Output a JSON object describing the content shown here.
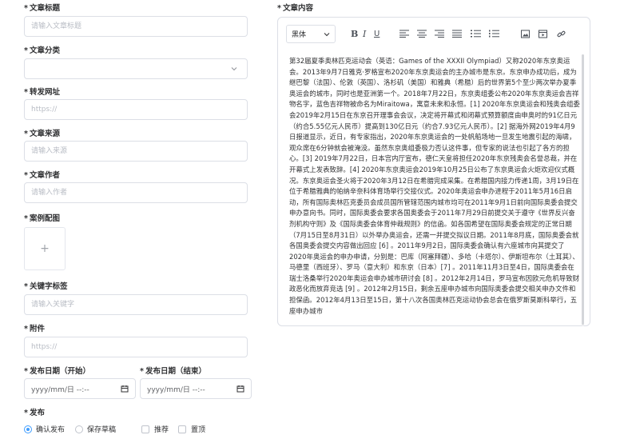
{
  "form": {
    "title_label": "文章标题",
    "title_placeholder": "请输入文章标题",
    "category_label": "文章分类",
    "url_label": "转发网址",
    "url_placeholder": "https://",
    "source_label": "文章来源",
    "source_placeholder": "请输入来源",
    "author_label": "文章作者",
    "author_placeholder": "请输入作者",
    "cover_label": "案例配图",
    "cover_plus": "+",
    "tags_label": "关键字标签",
    "tags_placeholder": "请输入关键字",
    "attachment_label": "附件",
    "attachment_placeholder": "https://",
    "start_date_label": "发布日期（开始）",
    "end_date_label": "发布日期（结束）",
    "date_placeholder": "yyyy/mm/日  --:--",
    "publish_label": "发布",
    "publish_options": [
      "确认发布",
      "保存草稿"
    ],
    "publish_selected": "确认发布",
    "checkboxes": [
      "推荐",
      "置顶"
    ],
    "required_mark": "*"
  },
  "editor": {
    "label": "文章内容",
    "font": "黑体",
    "bold": "B",
    "italic": "I",
    "underline": "U",
    "content": "第32届夏季奥林匹克运动会（英语：Games of the XXXII Olympiad）又称2020年东京奥运会。2013年9月7日雅克·罗格宣布2020年东京奥运会的主办城市是东京。东京申办成功后，成为继巴黎（法国）、伦敦（英国）、洛杉矶（美国）和雅典（希腊）后的世界第5个至少两次举办夏季奥运会的城市，同时也是亚洲第一个。2018年7月22日，东京奥组委公布2020年东京奥运会吉祥物名字，蓝色吉祥物被命名为Miraitowa，寓意未来和永恒。[1] 2020年东京奥运会和残奥会组委会2019年2月15日在东京召开理事会会议，决定将开幕式和闭幕式预算额度由申奥时的91亿日元（约合5.55亿元人民币）提高到130亿日元（约合7.93亿元人民币）。[2] 据海外网2019年4月9日报道显示，近日，有专家指出，2020年东京奥运会的一处帆船场地一旦发生地震引起的海啸，观众席在6分钟就会被淹没。虽然东京奥组委极力否认这件事，但专家的说法也引起了各方的担心。[3] 2019年7月22日，日本宫内厅宣布，德仁天皇将担任2020年东京残奥会名誉总裁，并在开幕式上发表致辞。[4] 2020年东京奥运会2019年10月25日公布了东京奥运会火炬欢迎仪式概况。东京奥运会圣火将于2020年3月12日在希腊完成采集。在希腊国内接力传递1周，3月19日在位于希腊雅典的帕纳辛奈科体育场举行交接仪式。2020年奥运会申办进程于2011年5月16日启动，所有国际奥林匹克委员会成员国所管辖范围内城市均可在2011年9月1日前向国际奥委会提交申办意向书。同时，国际奥委会要求各国奥委会于2011年7月29日前提交关于遵守《世界反兴奋剂机构守则》及《国际奥委会体育仲裁规则》的信函。如各国希望在国际奥委会规定的正常日期（7月15日至8月31日）以外举办奥运会，还需一并提交拟议日期。2011年8月底，国际奥委会就各国奥委会提交内容做出回应 [6] 。2011年9月2日，国际奥委会确认有六座城市向其提交了2020年奥运会的申办申请，分别是：巴库（阿塞拜疆）、多哈（卡塔尔）、伊斯坦布尔（土耳其）、马德里（西班牙）、罗马（意大利）和东京（日本）[7] 。2011年11月3日至4日，国际奥委会在瑞士洛桑举行2020年奥运会申办城市研讨会 [8] 。2012年2月14日，罗马宣布因欧元危机导致财政恶化而放弃竞选 [9] 。2012年2月15日，剩余五座申办城市向国际奥委会提交相关申办文件和担保函。2012年4月13日至15日，第十八次各国奥林匹克运动协会总会在俄罗斯莫斯科举行，五座申办城市"
  },
  "colors": {
    "accent": "#409eff",
    "border": "#dcdfe6",
    "placeholder": "#b8bcc4",
    "text": "#303133"
  }
}
